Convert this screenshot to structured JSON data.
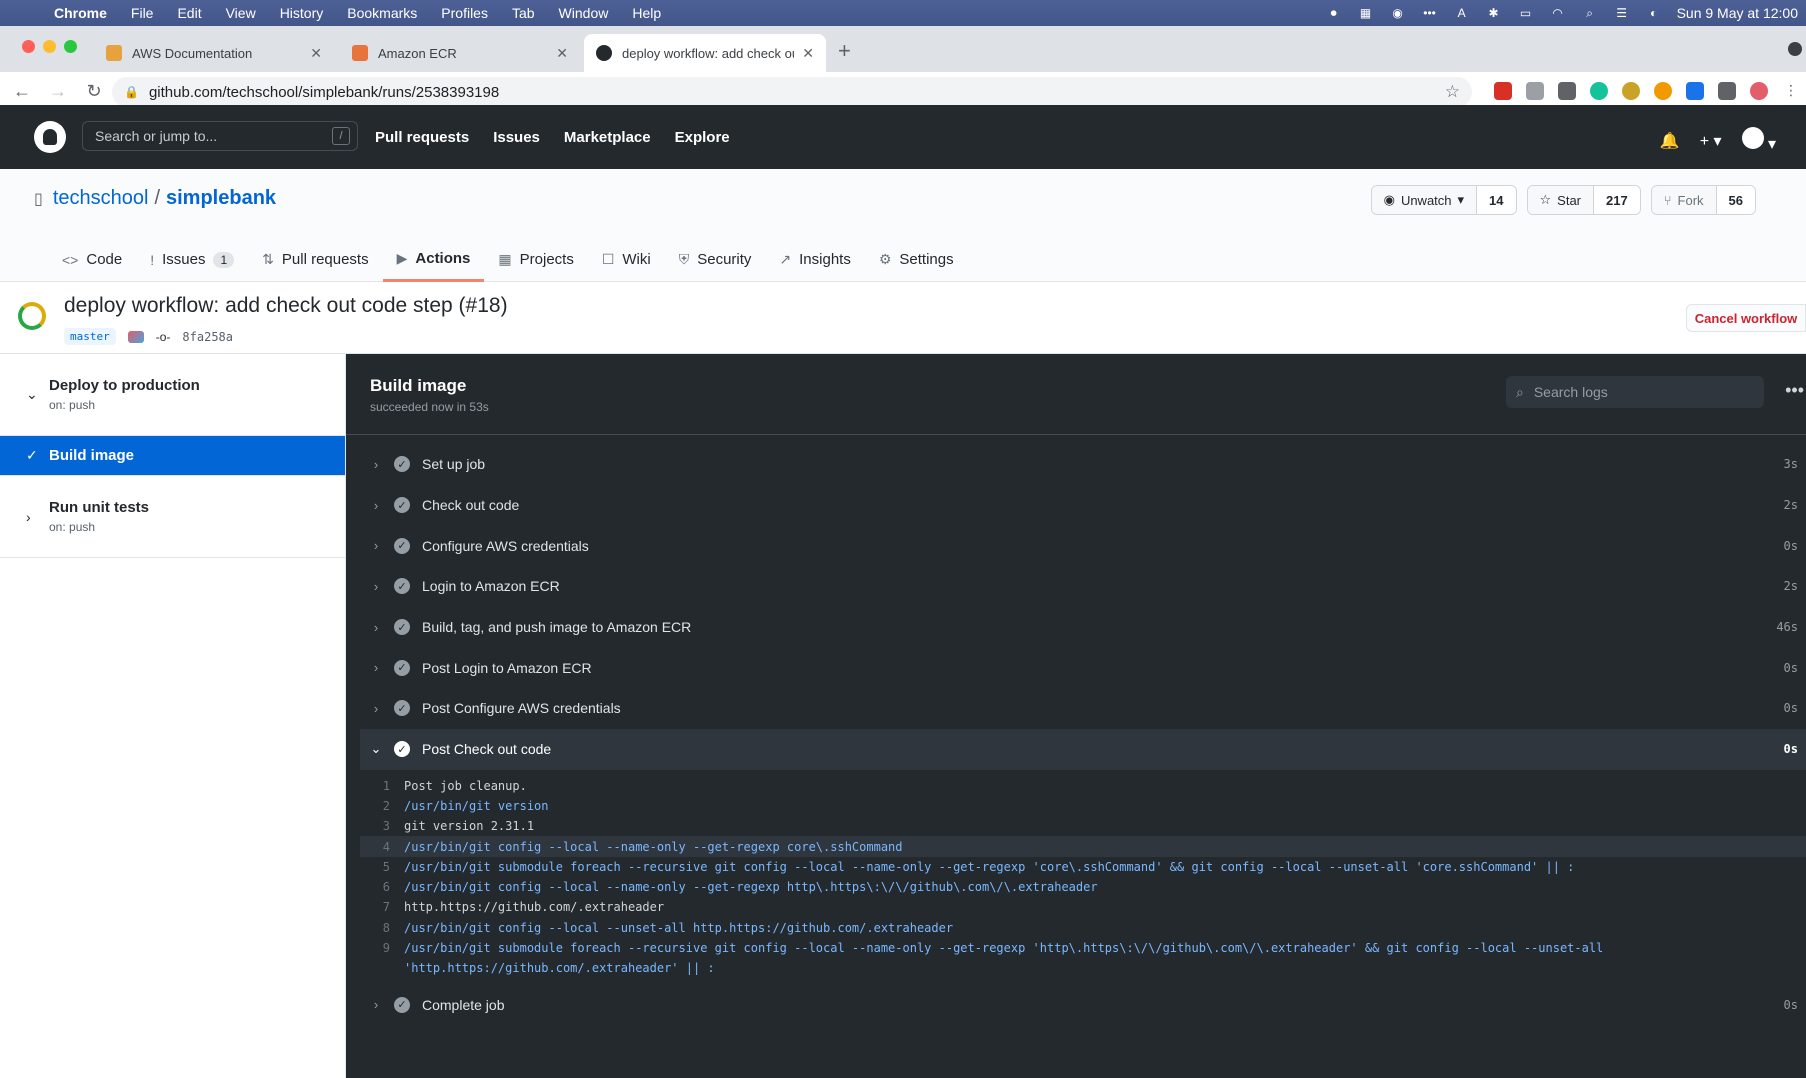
{
  "menubar": {
    "app": "Chrome",
    "items": [
      "File",
      "Edit",
      "View",
      "History",
      "Bookmarks",
      "Profiles",
      "Tab",
      "Window",
      "Help"
    ],
    "clock": "Sun 9 May at  12:00"
  },
  "browser": {
    "tabs": [
      {
        "title": "AWS Documentation",
        "color": "#e6a23c"
      },
      {
        "title": "Amazon ECR",
        "color": "#e8743b"
      },
      {
        "title": "deploy workflow: add check ou",
        "color": "#24292e"
      }
    ],
    "url": "github.com/techschool/simplebank/runs/2538393198"
  },
  "gh_header": {
    "search_placeholder": "Search or jump to...",
    "slash": "/",
    "nav": [
      "Pull requests",
      "Issues",
      "Marketplace",
      "Explore"
    ]
  },
  "repo": {
    "owner": "techschool",
    "separator": "/",
    "name": "simplebank",
    "unwatch_label": "Unwatch",
    "watch_count": "14",
    "star_label": "Star",
    "star_count": "217",
    "fork_label": "Fork",
    "fork_count": "56",
    "tabs": [
      {
        "label": "Code",
        "icon": "<>"
      },
      {
        "label": "Issues",
        "icon": "!",
        "count": "1"
      },
      {
        "label": "Pull requests",
        "icon": "⇅"
      },
      {
        "label": "Actions",
        "icon": "▶"
      },
      {
        "label": "Projects",
        "icon": "▦"
      },
      {
        "label": "Wiki",
        "icon": "☐"
      },
      {
        "label": "Security",
        "icon": "⛨"
      },
      {
        "label": "Insights",
        "icon": "↗"
      },
      {
        "label": "Settings",
        "icon": "⚙"
      }
    ]
  },
  "run": {
    "title": "deploy workflow: add check out code step (#18)",
    "branch": "master",
    "commit": "8fa258a",
    "cancel_label": "Cancel workflow"
  },
  "sidebar": {
    "workflow": {
      "name": "Deploy to production",
      "trigger": "on: push"
    },
    "selected_job": "Build image",
    "other_job": {
      "name": "Run unit tests",
      "trigger": "on: push"
    }
  },
  "log": {
    "job_title": "Build image",
    "status": "succeeded now in 53s",
    "search_placeholder": "Search logs",
    "steps": [
      {
        "name": "Set up job",
        "duration": "3s"
      },
      {
        "name": "Check out code",
        "duration": "2s"
      },
      {
        "name": "Configure AWS credentials",
        "duration": "0s"
      },
      {
        "name": "Login to Amazon ECR",
        "duration": "2s"
      },
      {
        "name": "Build, tag, and push image to Amazon ECR",
        "duration": "46s"
      },
      {
        "name": "Post Login to Amazon ECR",
        "duration": "0s"
      },
      {
        "name": "Post Configure AWS credentials",
        "duration": "0s"
      },
      {
        "name": "Post Check out code",
        "duration": "0s"
      },
      {
        "name": "Complete job",
        "duration": "0s"
      }
    ],
    "lines": [
      {
        "n": "1",
        "text": "Post job cleanup.",
        "cmd": false
      },
      {
        "n": "2",
        "text": "/usr/bin/git version",
        "cmd": true
      },
      {
        "n": "3",
        "text": "git version 2.31.1",
        "cmd": false
      },
      {
        "n": "4",
        "text": "/usr/bin/git config --local --name-only --get-regexp core\\.sshCommand",
        "cmd": true
      },
      {
        "n": "5",
        "text": "/usr/bin/git submodule foreach --recursive git config --local --name-only --get-regexp 'core\\.sshCommand' && git config --local --unset-all 'core.sshCommand' || :",
        "cmd": true
      },
      {
        "n": "6",
        "text": "/usr/bin/git config --local --name-only --get-regexp http\\.https\\:\\/\\/github\\.com\\/\\.extraheader",
        "cmd": true
      },
      {
        "n": "7",
        "text": "http.https://github.com/.extraheader",
        "cmd": false
      },
      {
        "n": "8",
        "text": "/usr/bin/git config --local --unset-all http.https://github.com/.extraheader",
        "cmd": true
      },
      {
        "n": "9",
        "text": "/usr/bin/git submodule foreach --recursive git config --local --name-only --get-regexp 'http\\.https\\:\\/\\/github\\.com\\/\\.extraheader' && git config --local --unset-all",
        "cmd": true
      },
      {
        "n": "",
        "text": "'http.https://github.com/.extraheader' || :",
        "cmd": true
      }
    ]
  }
}
